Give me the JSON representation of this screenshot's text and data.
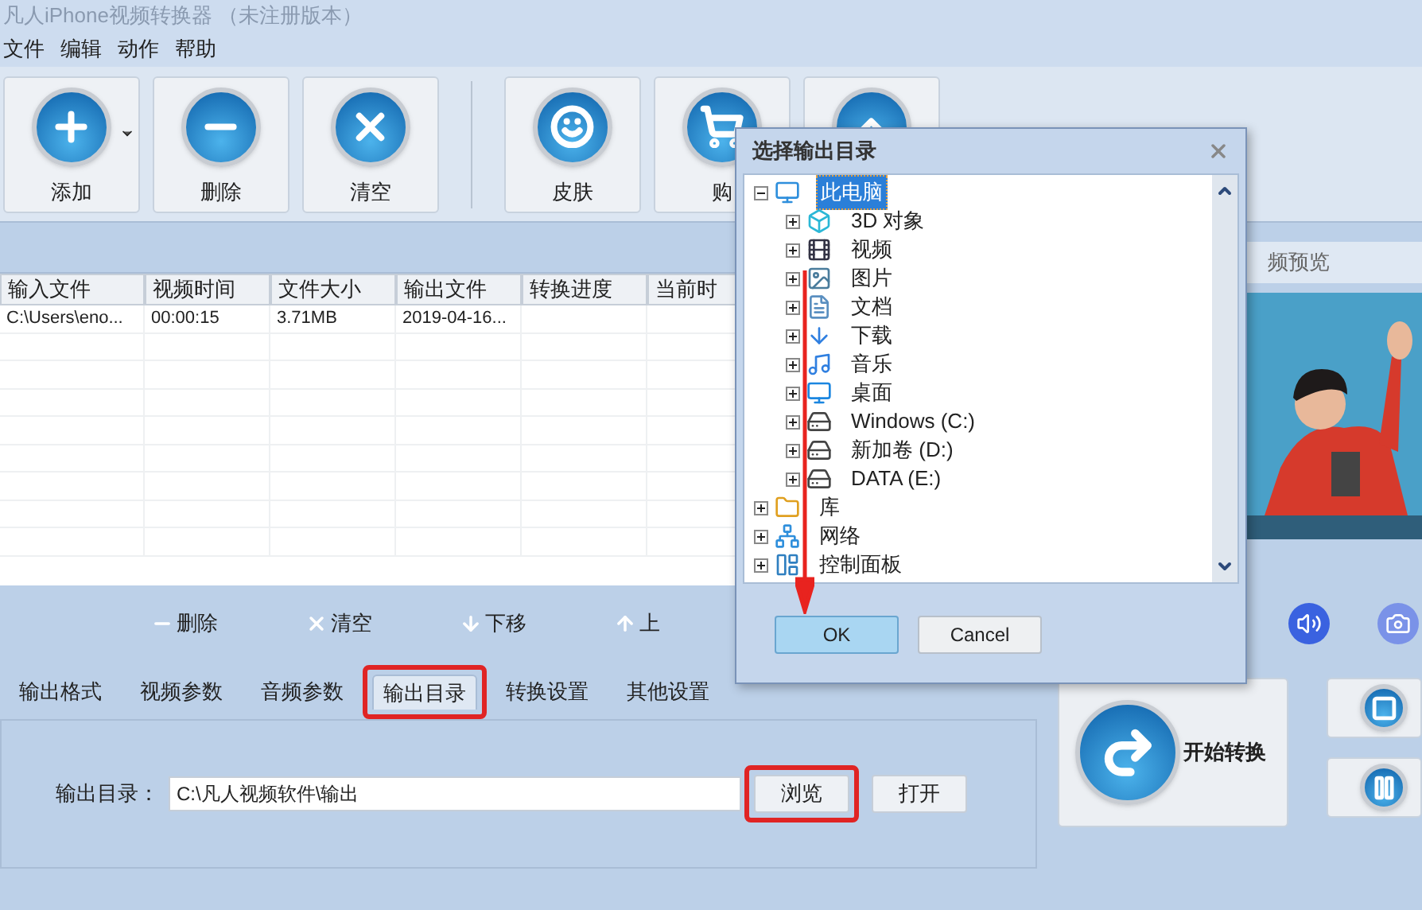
{
  "window": {
    "title": "凡人iPhone视频转换器 （未注册版本）"
  },
  "menu": [
    "文件",
    "编辑",
    "动作",
    "帮助"
  ],
  "toolbar": [
    {
      "label": "添加",
      "dropdown": true
    },
    {
      "label": "删除",
      "dropdown": false
    },
    {
      "label": "清空",
      "dropdown": false
    },
    {
      "label": "皮肤",
      "dropdown": false
    },
    {
      "label": "购"
    }
  ],
  "file_table": {
    "columns": [
      "输入文件",
      "视频时间",
      "文件大小",
      "输出文件",
      "转换进度",
      "当前时"
    ],
    "rows": [
      {
        "cells": [
          "C:\\Users\\eno...",
          "00:00:15",
          "3.71MB",
          "2019-04-16..."
        ]
      }
    ]
  },
  "preview": {
    "title": "频预览"
  },
  "list_actions": [
    {
      "label": "删除"
    },
    {
      "label": "清空"
    },
    {
      "label": "下移"
    },
    {
      "label": "上"
    }
  ],
  "tabs": [
    {
      "label": "输出格式",
      "selected": false,
      "highlighted": false
    },
    {
      "label": "视频参数",
      "selected": false,
      "highlighted": false
    },
    {
      "label": "音频参数",
      "selected": false,
      "highlighted": false
    },
    {
      "label": "输出目录",
      "selected": true,
      "highlighted": true
    },
    {
      "label": "转换设置",
      "selected": false,
      "highlighted": false
    },
    {
      "label": "其他设置",
      "selected": false,
      "highlighted": false
    }
  ],
  "output": {
    "label": "输出目录：",
    "value": "C:\\凡人视频软件\\输出",
    "buttons": [
      {
        "label": "浏览",
        "highlighted": true
      },
      {
        "label": "打开",
        "highlighted": false
      }
    ]
  },
  "convert": {
    "label": "开始转换"
  },
  "dialog": {
    "title": "选择输出目录",
    "tree": [
      {
        "label": "此电脑",
        "expanded": true,
        "selected": true,
        "children": [
          {
            "label": "3D 对象",
            "expanded": false,
            "selected": false
          },
          {
            "label": "视频",
            "expanded": false,
            "selected": false
          },
          {
            "label": "图片",
            "expanded": false,
            "selected": false
          },
          {
            "label": "文档",
            "expanded": false,
            "selected": false
          },
          {
            "label": "下载",
            "expanded": false,
            "selected": false
          },
          {
            "label": "音乐",
            "expanded": false,
            "selected": false
          },
          {
            "label": "桌面",
            "expanded": false,
            "selected": false
          },
          {
            "label": "Windows (C:)",
            "expanded": false,
            "selected": false
          },
          {
            "label": "新加卷 (D:)",
            "expanded": false,
            "selected": false
          },
          {
            "label": "DATA (E:)",
            "expanded": false,
            "selected": false
          }
        ]
      },
      {
        "label": "库",
        "expanded": false,
        "selected": false
      },
      {
        "label": "网络",
        "expanded": false,
        "selected": false
      },
      {
        "label": "控制面板",
        "expanded": false,
        "selected": false
      }
    ],
    "buttons": [
      {
        "label": "OK",
        "default": true
      },
      {
        "label": "Cancel",
        "default": false
      }
    ]
  }
}
